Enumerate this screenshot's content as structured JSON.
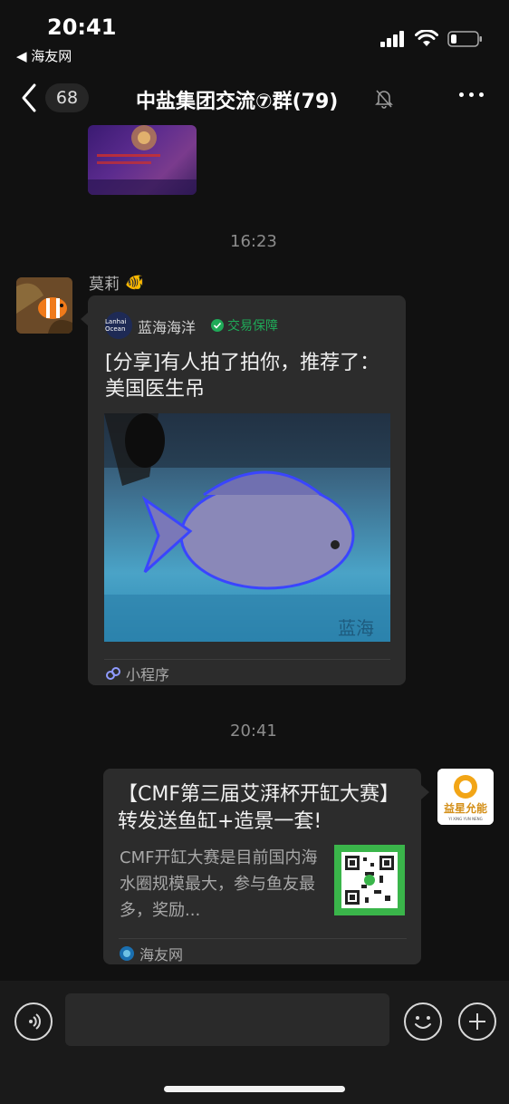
{
  "status_bar": {
    "time": "20:41",
    "back_app": "◀ 海友网",
    "signal_icon": "signal-bars-icon",
    "wifi_icon": "wifi-icon",
    "battery_icon": "battery-icon"
  },
  "nav": {
    "back_icon": "chevron-left-icon",
    "unread_count": "68",
    "title": "中盐集团交流⑦群(79)",
    "mute_icon": "bell-muted-icon",
    "more_icon": "more-dots-icon"
  },
  "messages": [
    {
      "type": "image",
      "from": "other"
    },
    {
      "type": "time",
      "text": "16:23"
    },
    {
      "type": "mini_program",
      "sender": "莫莉",
      "sender_emoji": "🐠",
      "app_logo_text": "Lanhai Ocean",
      "app_name": "蓝海海洋",
      "badge": "交易保障",
      "title": "[分享]有人拍了拍你，推荐了：美国医生吊",
      "watermark": "蓝海",
      "footer": "小程序"
    },
    {
      "type": "time",
      "text": "20:41"
    },
    {
      "type": "article",
      "from": "self",
      "title": "【CMF第三届艾湃杯开缸大赛】转发送鱼缸+造景一套!",
      "desc": "CMF开缸大赛是目前国内海水圈规模最大，参与鱼友最多，奖励...",
      "source": "海友网",
      "avatar_text": "益星允能",
      "avatar_subtext": "YI XING YUN NENG"
    }
  ],
  "input_bar": {
    "voice_icon": "voice-icon",
    "input_placeholder": "",
    "emoji_icon": "emoji-icon",
    "plus_icon": "plus-icon"
  },
  "colors": {
    "background": "#111111",
    "bubble": "#2c2c2c",
    "badge_green": "#1faa58"
  }
}
